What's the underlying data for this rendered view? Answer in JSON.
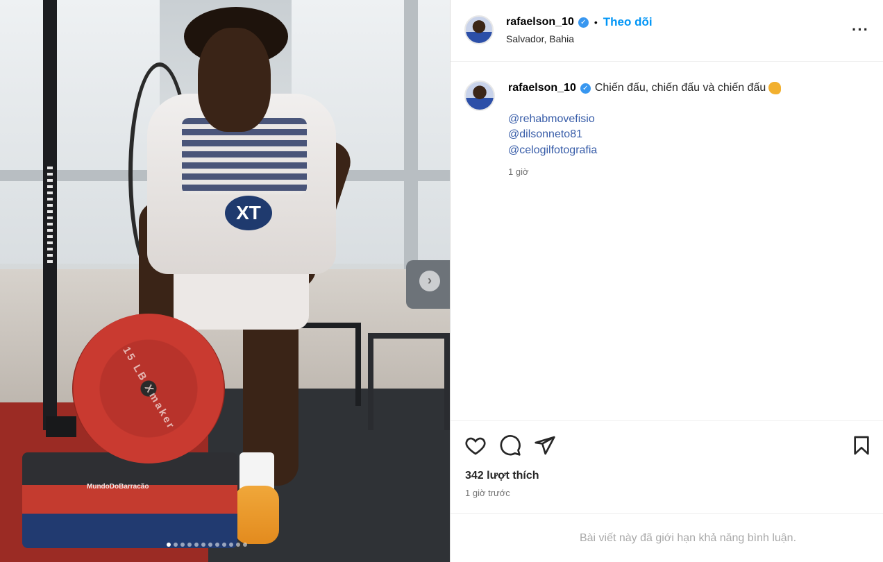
{
  "post": {
    "username": "rafaelson_10",
    "verified_badge": "✓",
    "separator": "•",
    "follow_label": "Theo dõi",
    "location": "Salvador, Bahia",
    "more_label": "···"
  },
  "caption": {
    "username": "rafaelson_10",
    "text": "Chiến đấu, chiến đấu và chiến đấu",
    "emoji": "flexed-biceps",
    "mentions": [
      "@rehabmovefisio",
      "@dilsonneto81",
      "@celogilfotografia"
    ],
    "time": "1 giờ"
  },
  "media": {
    "plate_text": "15 LB  Xmaker",
    "shirt_logo": "XT",
    "platform_brand": "MundoDoBarracão",
    "next_arrow": "›",
    "carousel_count": 12,
    "carousel_active_index": 0
  },
  "actions": {
    "likes": "342 lượt thích",
    "posted": "1 giờ trước",
    "icons": [
      "heart-icon",
      "comment-icon",
      "share-icon",
      "bookmark-icon"
    ]
  },
  "footer": {
    "limited_comments": "Bài viết này đã giới hạn khả năng bình luận."
  },
  "colors": {
    "follow": "#0095f6",
    "mention": "#375ca8",
    "verified": "#3897f0",
    "muted": "#737373"
  }
}
